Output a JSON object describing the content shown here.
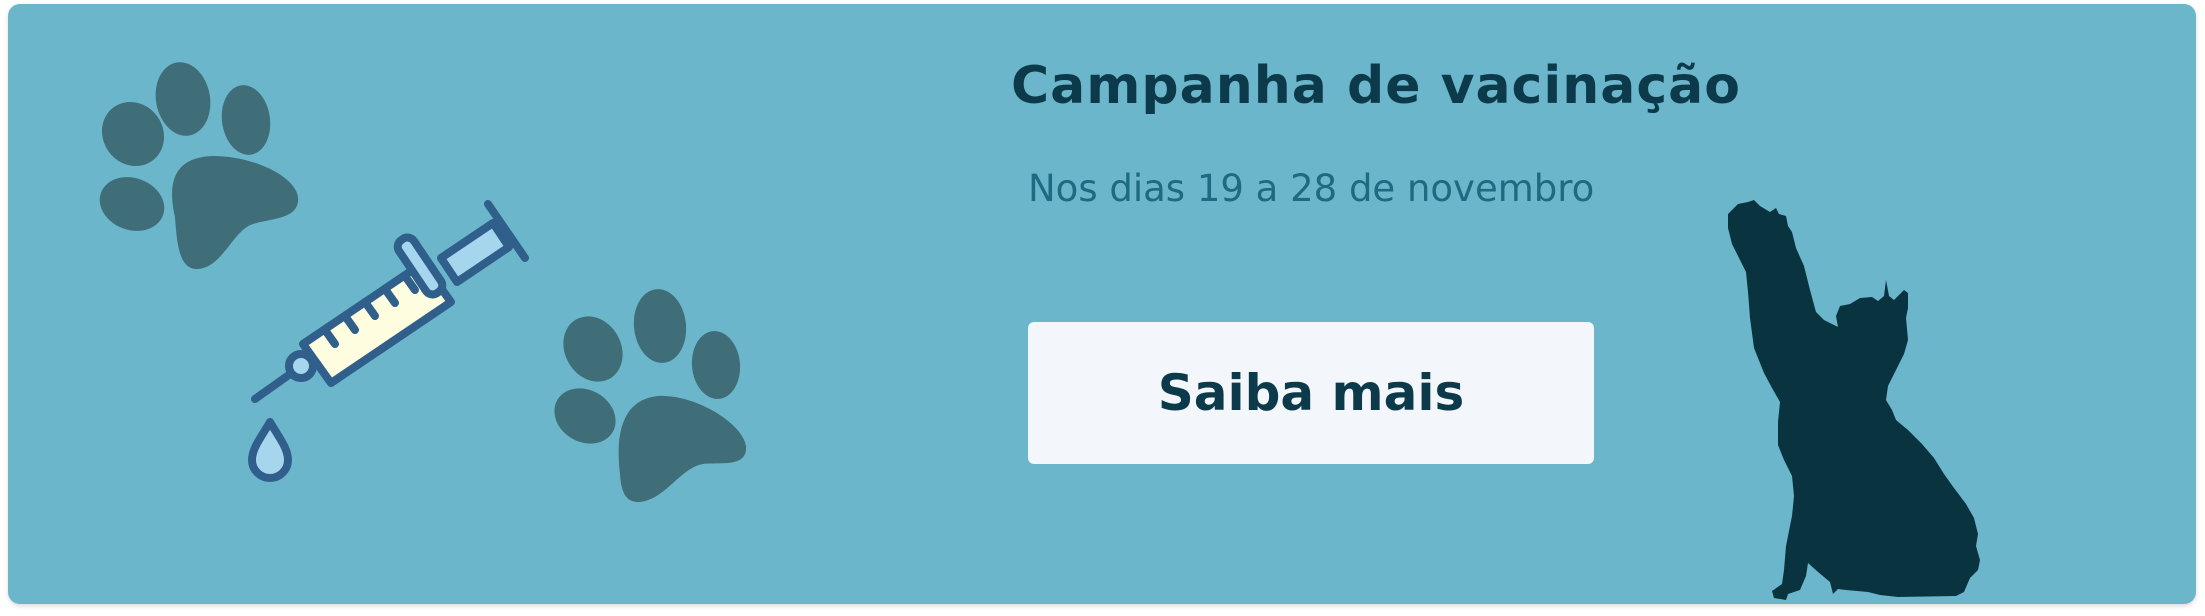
{
  "banner": {
    "title": "Campanha de vacinação",
    "subtitle": "Nos dias 19 a 28 de novembro",
    "cta_label": "Saiba mais"
  },
  "colors": {
    "background": "#6bb6cb",
    "title": "#0c3a4a",
    "subtitle": "#1d6b80",
    "button_bg": "#f3f6fb",
    "paw": "#3f6d78",
    "syringe_stroke": "#2f5f8a",
    "syringe_liquid": "#fffde0",
    "syringe_light": "#a6d6ee",
    "cat": "#0a3340"
  },
  "icons": [
    "paw-print-icon",
    "syringe-icon",
    "drop-icon",
    "cat-silhouette-icon"
  ]
}
